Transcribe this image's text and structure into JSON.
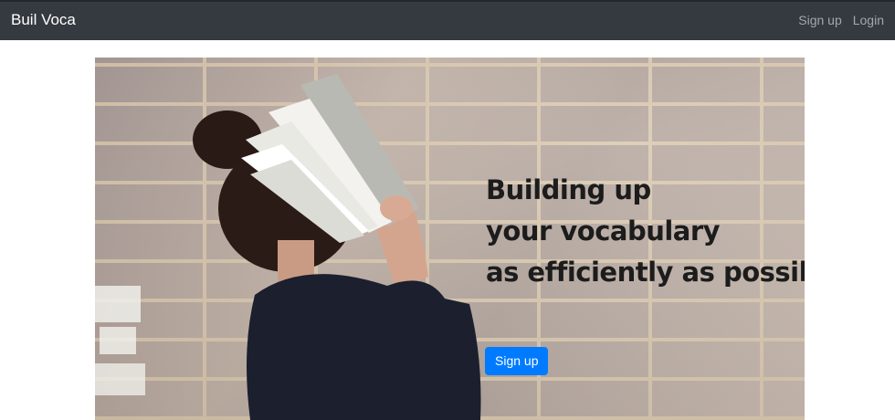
{
  "navbar": {
    "brand": "Buil Voca",
    "links": [
      {
        "label": "Sign up"
      },
      {
        "label": "Login"
      }
    ]
  },
  "hero": {
    "image": "woman-with-book-over-face-brick-wall",
    "headline": [
      "Building up",
      "your vocabulary",
      "as efficiently as possible"
    ],
    "cta_label": "Sign up",
    "cta_color": "#007bff"
  },
  "colors": {
    "navbar_bg": "#343a40",
    "brand_text": "#ffffff",
    "nav_link_text": "#a4a8ac"
  }
}
